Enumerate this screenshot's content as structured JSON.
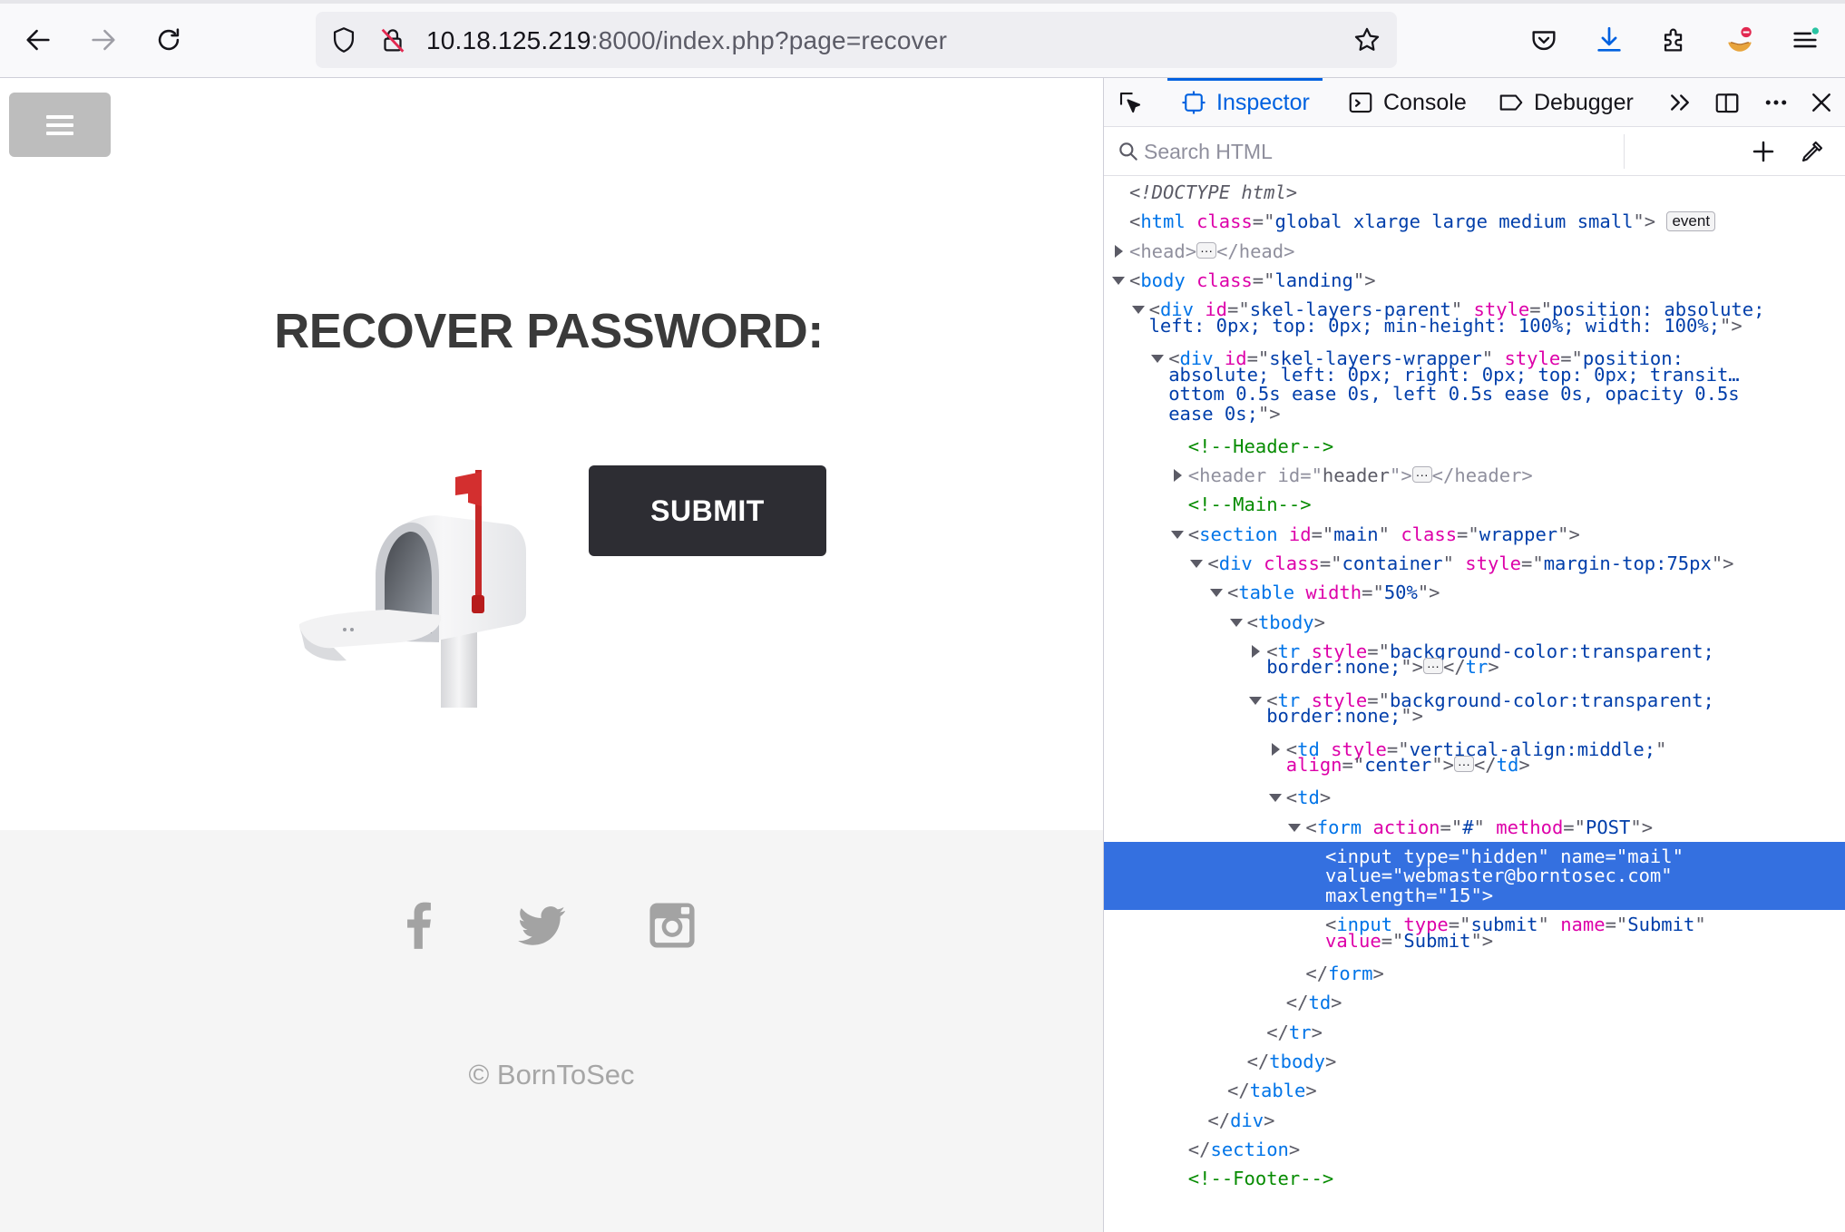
{
  "browser": {
    "url_host": "10.18.125.219",
    "url_rest": ":8000/index.php?page=recover"
  },
  "page": {
    "title": "RECOVER PASSWORD:",
    "submit_label": "SUBMIT",
    "copyright": "© BornToSec"
  },
  "devtools": {
    "tabs": [
      "Inspector",
      "Console",
      "Debugger"
    ],
    "active_tab": "Inspector",
    "search_placeholder": "Search HTML",
    "event_badge": "event",
    "selected_row": 26,
    "markup": [
      {
        "depth": 0,
        "tw": "",
        "html": "<span class='d'>&lt;!DOCTYPE html&gt;</span>"
      },
      {
        "depth": 0,
        "tw": "",
        "html": "<span class='p'>&lt;</span><span class='t'>html</span> <span class='a'>class</span><span class='p'>=\"</span><span class='v'>global xlarge large medium small</span><span class='p'>\"&gt;</span> <span class='badge'>event</span>"
      },
      {
        "depth": 0,
        "tw": "closed",
        "html": "<span class='dim'>&lt;head&gt;</span><span class='ell'>···</span><span class='dim'>&lt;/head&gt;</span>"
      },
      {
        "depth": 0,
        "tw": "open",
        "html": "<span class='p'>&lt;</span><span class='t'>body</span> <span class='a'>class</span><span class='p'>=\"</span><span class='v'>landing</span><span class='p'>\"&gt;</span>"
      },
      {
        "depth": 1,
        "tw": "open",
        "html": "<span class='p'>&lt;</span><span class='t'>div</span> <span class='a'>id</span><span class='p'>=\"</span><span class='v'>skel-layers-parent</span><span class='p'>\"</span> <span class='a'>style</span><span class='p'>=\"</span><span class='v'>position: absolute;</span>"
      },
      {
        "depth": 1,
        "tw": "",
        "cont": true,
        "html": "<span class='v'>left: 0px; top: 0px; min-height: 100%; width: 100%;</span><span class='p'>\"&gt;</span>"
      },
      {
        "depth": 2,
        "tw": "open",
        "html": "<span class='p'>&lt;</span><span class='t'>div</span> <span class='a'>id</span><span class='p'>=\"</span><span class='v'>skel-layers-wrapper</span><span class='p'>\"</span> <span class='a'>style</span><span class='p'>=\"</span><span class='v'>position:</span>"
      },
      {
        "depth": 2,
        "tw": "",
        "cont": true,
        "html": "<span class='v'>absolute; left: 0px; right: 0px; top: 0px; transit…</span>"
      },
      {
        "depth": 2,
        "tw": "",
        "cont": true,
        "html": "<span class='v'>ottom 0.5s ease 0s, left 0.5s ease 0s, opacity 0.5s</span>"
      },
      {
        "depth": 2,
        "tw": "",
        "cont": true,
        "html": "<span class='v'>ease 0s;</span><span class='p'>\"&gt;</span>"
      },
      {
        "depth": 3,
        "tw": "",
        "html": "<span class='c'>&lt;!--Header--&gt;</span>"
      },
      {
        "depth": 3,
        "tw": "closed",
        "html": "<span class='dim'>&lt;header</span> <span class='dim'>id=\"</span><span class='p'>header</span><span class='dim'>\"&gt;</span><span class='ell'>···</span><span class='dim'>&lt;/header&gt;</span>"
      },
      {
        "depth": 3,
        "tw": "",
        "html": "<span class='c'>&lt;!--Main--&gt;</span>"
      },
      {
        "depth": 3,
        "tw": "open",
        "html": "<span class='p'>&lt;</span><span class='t'>section</span> <span class='a'>id</span><span class='p'>=\"</span><span class='v'>main</span><span class='p'>\"</span> <span class='a'>class</span><span class='p'>=\"</span><span class='v'>wrapper</span><span class='p'>\"&gt;</span>"
      },
      {
        "depth": 4,
        "tw": "open",
        "html": "<span class='p'>&lt;</span><span class='t'>div</span> <span class='a'>class</span><span class='p'>=\"</span><span class='v'>container</span><span class='p'>\"</span> <span class='a'>style</span><span class='p'>=\"</span><span class='v'>margin-top:75px</span><span class='p'>\"&gt;</span>"
      },
      {
        "depth": 5,
        "tw": "open",
        "html": "<span class='p'>&lt;</span><span class='t'>table</span> <span class='a'>width</span><span class='p'>=\"</span><span class='v'>50%</span><span class='p'>\"&gt;</span>"
      },
      {
        "depth": 6,
        "tw": "open",
        "html": "<span class='p'>&lt;</span><span class='t'>tbody</span><span class='p'>&gt;</span>"
      },
      {
        "depth": 7,
        "tw": "closed",
        "html": "<span class='p'>&lt;</span><span class='t'>tr</span> <span class='a'>style</span><span class='p'>=\"</span><span class='v'>background-color:transparent;</span>"
      },
      {
        "depth": 7,
        "tw": "",
        "cont": true,
        "html": "<span class='v'>border:none;</span><span class='p'>\"&gt;</span><span class='ell'>···</span><span class='p'>&lt;/</span><span class='t'>tr</span><span class='p'>&gt;</span>"
      },
      {
        "depth": 7,
        "tw": "open",
        "html": "<span class='p'>&lt;</span><span class='t'>tr</span> <span class='a'>style</span><span class='p'>=\"</span><span class='v'>background-color:transparent;</span>"
      },
      {
        "depth": 7,
        "tw": "",
        "cont": true,
        "html": "<span class='v'>border:none;</span><span class='p'>\"&gt;</span>"
      },
      {
        "depth": 8,
        "tw": "closed",
        "html": "<span class='p'>&lt;</span><span class='t'>td</span> <span class='a'>style</span><span class='p'>=\"</span><span class='v'>vertical-align:middle;</span><span class='p'>\"</span>"
      },
      {
        "depth": 8,
        "tw": "",
        "cont": true,
        "html": "<span class='a'>align</span><span class='p'>=\"</span><span class='v'>center</span><span class='p'>\"&gt;</span><span class='ell'>···</span><span class='p'>&lt;/</span><span class='t'>td</span><span class='p'>&gt;</span>"
      },
      {
        "depth": 8,
        "tw": "open",
        "html": "<span class='p'>&lt;</span><span class='t'>td</span><span class='p'>&gt;</span>"
      },
      {
        "depth": 9,
        "tw": "open",
        "html": "<span class='p'>&lt;</span><span class='t'>form</span> <span class='a'>action</span><span class='p'>=\"</span><span class='v'>#</span><span class='p'>\"</span> <span class='a'>method</span><span class='p'>=\"</span><span class='v'>POST</span><span class='p'>\"&gt;</span>"
      },
      {
        "depth": 10,
        "tw": "",
        "html": "<span>&lt;input type=\"hidden\" name=\"mail\"</span>",
        "sel": true,
        "multi": [
          "&lt;input type=\"hidden\" name=\"mail\"",
          "value=\"webmaster@borntosec.com\"",
          "maxlength=\"15\"&gt;"
        ]
      },
      {
        "depth": 10,
        "tw": "",
        "html": "<span class='p'>&lt;</span><span class='t'>input</span> <span class='a'>type</span><span class='p'>=\"</span><span class='v'>submit</span><span class='p'>\"</span> <span class='a'>name</span><span class='p'>=\"</span><span class='v'>Submit</span><span class='p'>\"</span>"
      },
      {
        "depth": 10,
        "tw": "",
        "cont": true,
        "html": "<span class='a'>value</span><span class='p'>=\"</span><span class='v'>Submit</span><span class='p'>\"&gt;</span>"
      },
      {
        "depth": 9,
        "tw": "",
        "html": "<span class='p'>&lt;/</span><span class='t'>form</span><span class='p'>&gt;</span>"
      },
      {
        "depth": 8,
        "tw": "",
        "html": "<span class='p'>&lt;/</span><span class='t'>td</span><span class='p'>&gt;</span>"
      },
      {
        "depth": 7,
        "tw": "",
        "html": "<span class='p'>&lt;/</span><span class='t'>tr</span><span class='p'>&gt;</span>"
      },
      {
        "depth": 6,
        "tw": "",
        "html": "<span class='p'>&lt;/</span><span class='t'>tbody</span><span class='p'>&gt;</span>"
      },
      {
        "depth": 5,
        "tw": "",
        "html": "<span class='p'>&lt;/</span><span class='t'>table</span><span class='p'>&gt;</span>"
      },
      {
        "depth": 4,
        "tw": "",
        "html": "<span class='p'>&lt;/</span><span class='t'>div</span><span class='p'>&gt;</span>"
      },
      {
        "depth": 3,
        "tw": "",
        "html": "<span class='p'>&lt;/</span><span class='t'>section</span><span class='p'>&gt;</span>"
      },
      {
        "depth": 3,
        "tw": "",
        "html": "<span class='c'>&lt;!--Footer--&gt;</span>"
      }
    ]
  }
}
